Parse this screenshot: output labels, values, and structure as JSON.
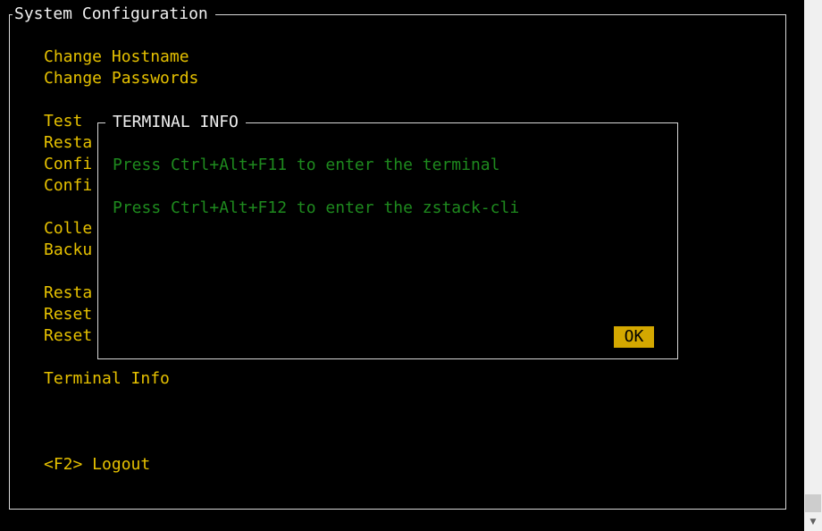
{
  "window": {
    "title": "System Configuration"
  },
  "menu": {
    "items": [
      "Change Hostname",
      "Change Passwords",
      "Test",
      "Resta",
      "Confi",
      "Confi",
      "Colle",
      "Backu",
      "Resta",
      "Reset",
      "Reset",
      "Terminal Info",
      "<F2> Logout"
    ]
  },
  "dialog": {
    "title": "TERMINAL INFO",
    "line1": "Press Ctrl+Alt+F11 to enter the terminal",
    "line2": "Press Ctrl+Alt+F12 to enter the zstack-cli",
    "ok_label": "OK"
  },
  "colors": {
    "background": "#000000",
    "menu_text": "#e6c100",
    "dialog_text": "#1e8a1e",
    "button_bg": "#d4a800",
    "frame": "#d8d8d8"
  },
  "icons": {
    "scroll_down": "chevron-down-icon"
  }
}
